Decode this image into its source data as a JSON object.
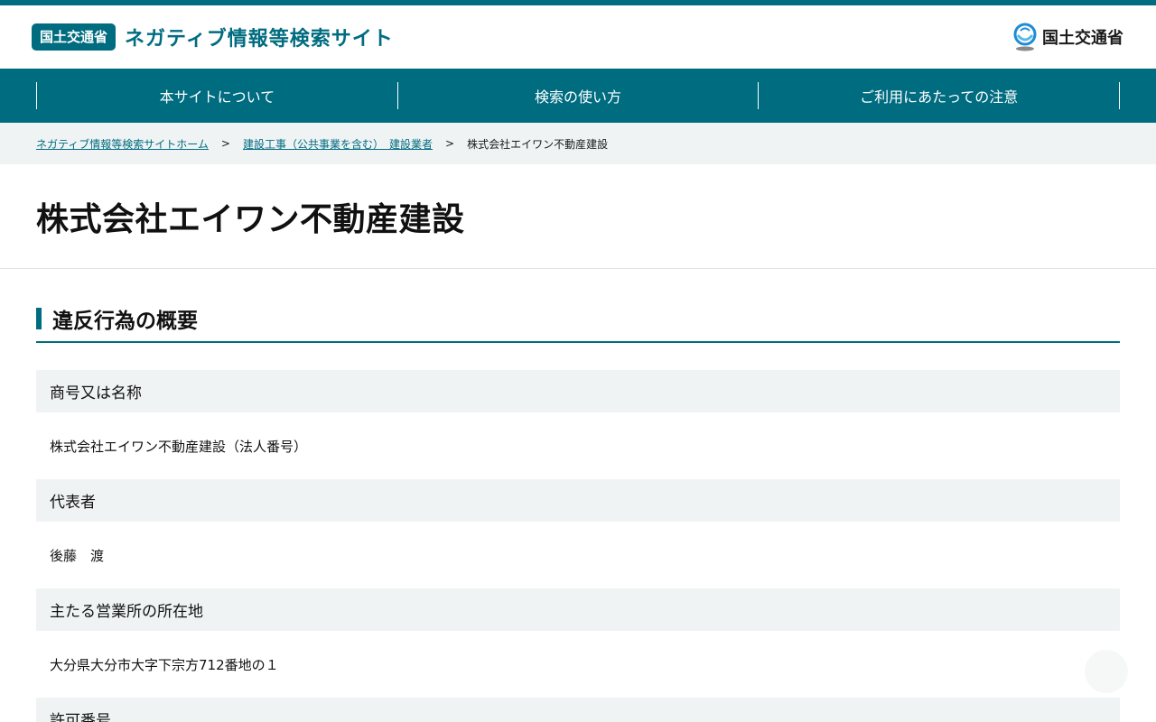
{
  "header": {
    "ministry_badge": "国土交通省",
    "site_title": "ネガティブ情報等検索サイト",
    "ministry_logo_text": "国土交通省"
  },
  "nav": {
    "items": [
      {
        "label": "本サイトについて"
      },
      {
        "label": "検索の使い方"
      },
      {
        "label": "ご利用にあたっての注意"
      }
    ]
  },
  "breadcrumb": {
    "home": "ネガティブ情報等検索サイトホーム",
    "category": "建設工事（公共事業を含む）　建設業者",
    "current": "株式会社エイワン不動産建設",
    "separator": ">"
  },
  "page": {
    "title": "株式会社エイワン不動産建設"
  },
  "section": {
    "heading": "違反行為の概要"
  },
  "fields": [
    {
      "label": "商号又は名称",
      "value": "株式会社エイワン不動産建設（法人番号）"
    },
    {
      "label": "代表者",
      "value": "後藤　渡"
    },
    {
      "label": "主たる営業所の所在地",
      "value": "大分県大分市大字下宗方712番地の１"
    },
    {
      "label": "許可番号",
      "value": ""
    }
  ],
  "colors": {
    "brand": "#006c80",
    "label_bg": "#f0f3f4"
  }
}
